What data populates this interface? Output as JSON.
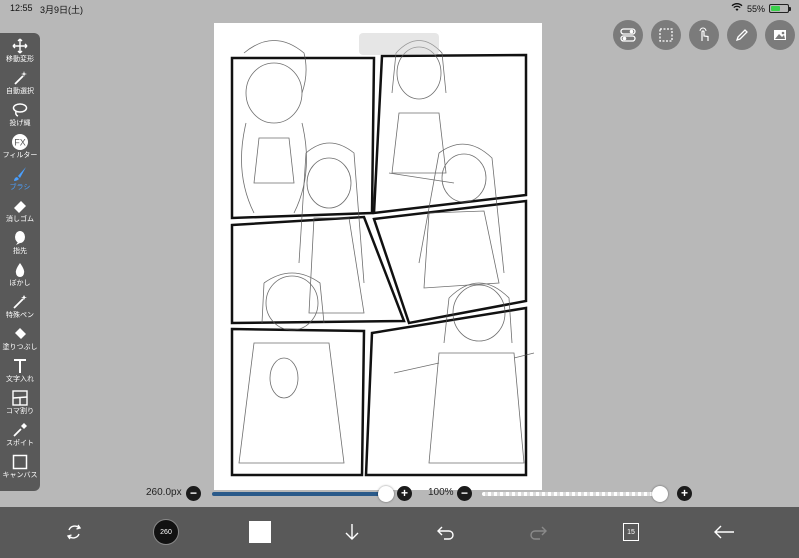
{
  "status_bar": {
    "time": "12:55",
    "date": "3月9日(土)",
    "battery_percent": "55%",
    "battery_level": 0.55
  },
  "toolbar": {
    "tools": [
      {
        "name": "move-transform",
        "label": "移動変形",
        "icon": "move-icon"
      },
      {
        "name": "magic-wand",
        "label": "自動選択",
        "icon": "magic-wand-icon"
      },
      {
        "name": "lasso",
        "label": "投げ縄",
        "icon": "lasso-icon"
      },
      {
        "name": "filter",
        "label": "フィルター",
        "icon": "fx-icon"
      },
      {
        "name": "brush",
        "label": "ブラシ",
        "icon": "brush-icon",
        "active": true
      },
      {
        "name": "eraser",
        "label": "消しゴム",
        "icon": "eraser-icon"
      },
      {
        "name": "finger",
        "label": "指先",
        "icon": "finger-icon"
      },
      {
        "name": "blur",
        "label": "ぼかし",
        "icon": "blur-drop-icon"
      },
      {
        "name": "special-pen",
        "label": "特殊ペン",
        "icon": "special-pen-icon"
      },
      {
        "name": "fill",
        "label": "塗りつぶし",
        "icon": "fill-bucket-icon"
      },
      {
        "name": "text",
        "label": "文字入れ",
        "icon": "text-icon"
      },
      {
        "name": "frame-divider",
        "label": "コマ割り",
        "icon": "frame-icon"
      },
      {
        "name": "eyedropper",
        "label": "スポイト",
        "icon": "eyedropper-icon"
      },
      {
        "name": "canvas",
        "label": "キャンバス",
        "icon": "canvas-icon"
      }
    ]
  },
  "sliders": {
    "size_label": "260.0px",
    "size_value": 260.0,
    "size_fraction": 0.98,
    "opacity_label": "100%",
    "opacity_fraction": 1.0
  },
  "bottom_bar": {
    "brush_size_badge": "260",
    "layer_count": "15"
  },
  "colors": {
    "accent": "#4aa0ff",
    "toolbar_bg": "#595959",
    "size_track": "#2a5a8a"
  }
}
